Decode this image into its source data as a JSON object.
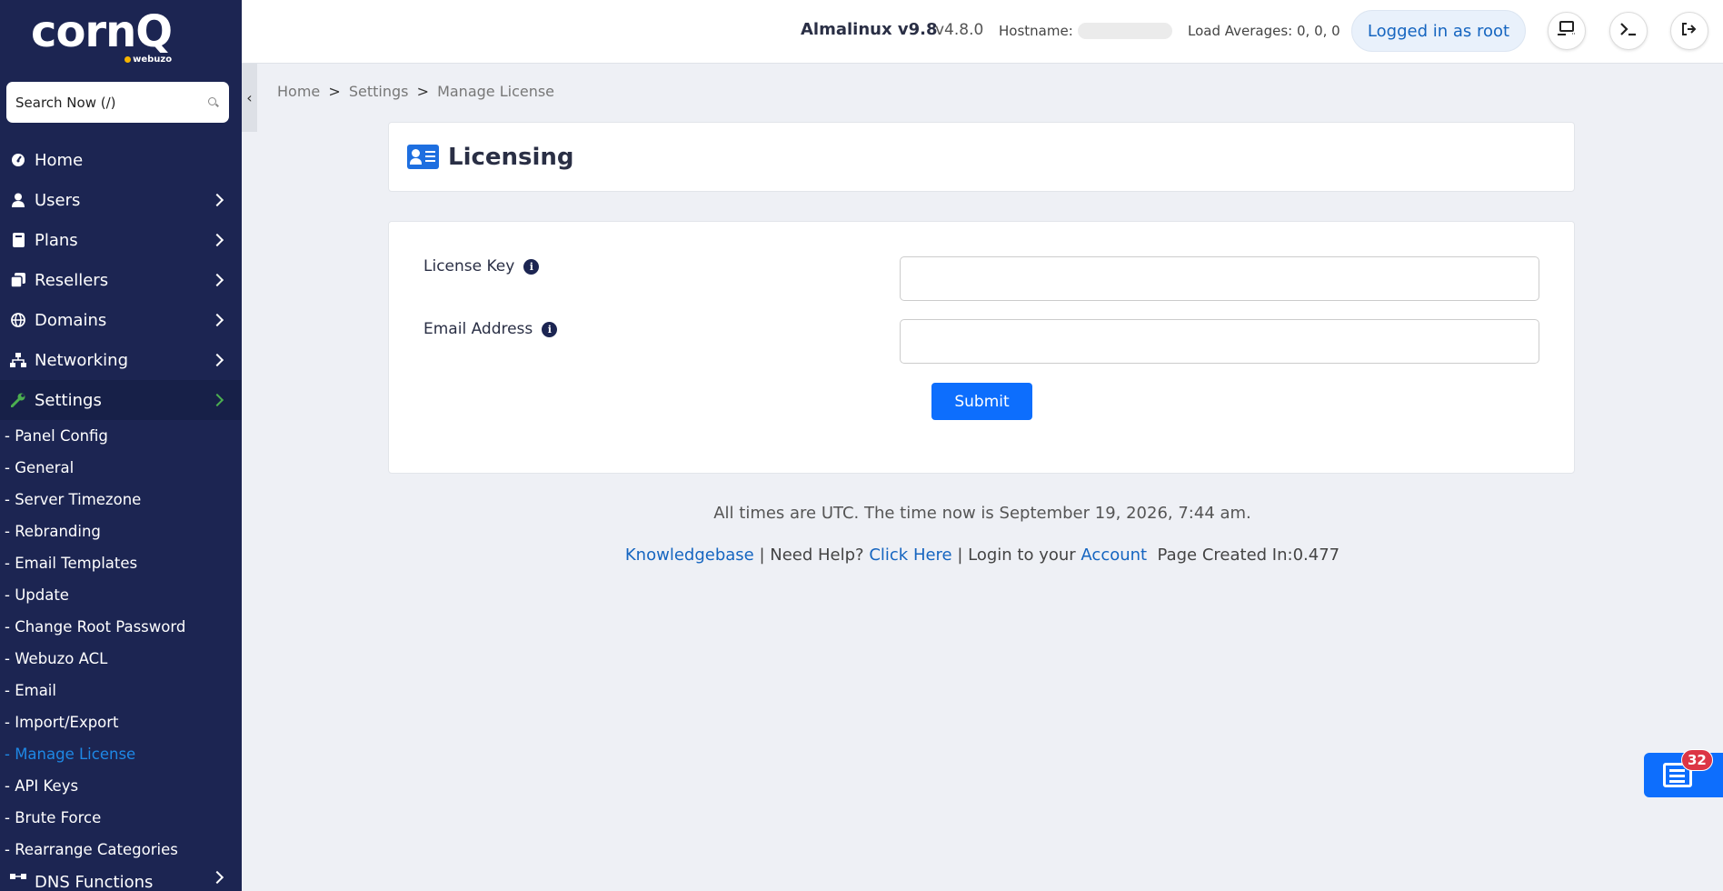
{
  "brand": {
    "logo_text": "cornQ",
    "logo_sub": "webuzo"
  },
  "search": {
    "placeholder": "Search Now (/)"
  },
  "sidebar": {
    "items": [
      {
        "label": "Home",
        "icon": "dashboard-icon"
      },
      {
        "label": "Users",
        "icon": "user-icon"
      },
      {
        "label": "Plans",
        "icon": "book-icon"
      },
      {
        "label": "Resellers",
        "icon": "copy-icon"
      },
      {
        "label": "Domains",
        "icon": "globe-icon"
      },
      {
        "label": "Networking",
        "icon": "network-icon"
      },
      {
        "label": "Settings",
        "icon": "wrench-icon"
      }
    ],
    "settings_sub": [
      "- Panel Config",
      "- General",
      "- Server Timezone",
      "- Rebranding",
      "- Email Templates",
      "- Update",
      "- Change Root Password",
      "- Webuzo ACL",
      "- Email",
      "- Import/Export",
      "- Manage License",
      "- API Keys",
      "- Brute Force",
      "- Rearrange Categories"
    ],
    "dns_label": "DNS Functions"
  },
  "header": {
    "os": "Almalinux v9.8",
    "version": "v4.8.0",
    "hostname_label": "Hostname:",
    "load_averages": "Load Averages: 0, 0, 0",
    "logged_in": "Logged in as root"
  },
  "breadcrumb": {
    "home": "Home",
    "settings": "Settings",
    "current": "Manage License",
    "sep": ">"
  },
  "page": {
    "title": "Licensing"
  },
  "form": {
    "license_key_label": "License Key",
    "email_label": "Email Address",
    "license_key_value": "",
    "email_value": "",
    "submit_label": "Submit"
  },
  "footer": {
    "time_text": "All times are UTC. The time now is September 19, 2026, 7:44 am.",
    "kb_link": "Knowledgebase",
    "sep1": " | Need Help? ",
    "help_link": "Click Here",
    "sep2": " | Login to your ",
    "account_link": "Account",
    "page_created": "  Page Created In:0.477"
  },
  "notifications": {
    "count": "32"
  },
  "colors": {
    "sidebar_bg": "#1c2552",
    "accent": "#0d6efd",
    "active_sub": "#1e88e5",
    "settings_icon": "#4caf50",
    "badge": "#dc3545"
  }
}
